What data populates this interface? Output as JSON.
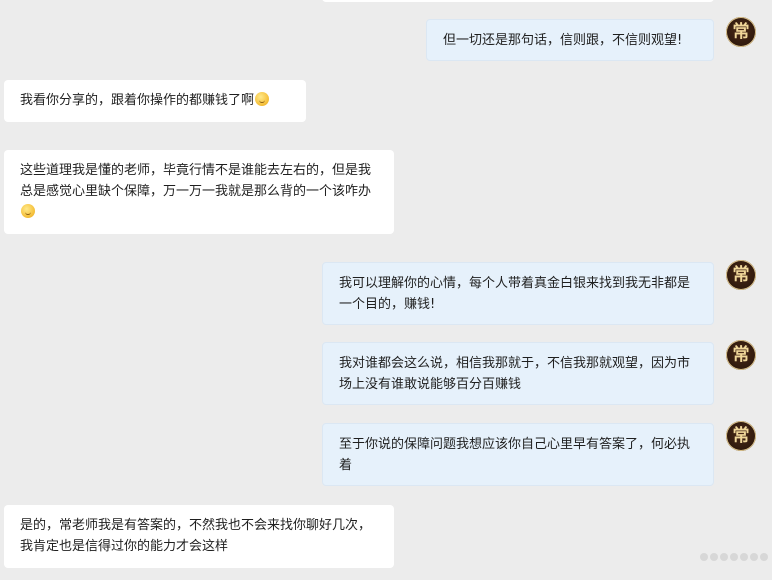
{
  "chat": {
    "messages": [
      {
        "sender": "contact",
        "text": ""
      },
      {
        "sender": "self",
        "avatar_char": "常",
        "text": "但一切还是那句话，信则跟，不信则观望!"
      },
      {
        "sender": "contact",
        "text": "我看你分享的，跟着你操作的都赚钱了啊",
        "emoji": "laughing-crying-emoji"
      },
      {
        "sender": "contact",
        "text": "这些道理我是懂的老师，毕竟行情不是谁能去左右的，但是我总是感觉心里缺个保障，万一万一我就是那么背的一个该咋办",
        "emoji": "sweat-smile-emoji"
      },
      {
        "sender": "self",
        "avatar_char": "常",
        "text": "我可以理解你的心情，每个人带着真金白银来找到我无非都是一个目的，赚钱!"
      },
      {
        "sender": "self",
        "avatar_char": "常",
        "text": "我对谁都会这么说，相信我那就于，不信我那就观望，因为市场上没有谁敢说能够百分百赚钱"
      },
      {
        "sender": "self",
        "avatar_char": "常",
        "text": "至于你说的保障问题我想应该你自己心里早有答案了，何必执着"
      },
      {
        "sender": "contact",
        "text": "是的，常老师我是有答案的，不然我也不会来找你聊好几次，我肯定也是信得过你的能力才会这样"
      }
    ]
  },
  "colors": {
    "background": "#ececec",
    "incoming_bubble": "#ffffff",
    "outgoing_bubble": "#e6f1fb",
    "avatar_bg": "#2f190d",
    "avatar_text": "#f0d79a"
  }
}
